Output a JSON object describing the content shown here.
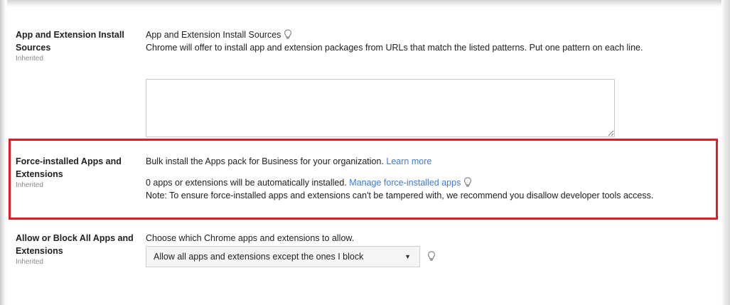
{
  "sections": [
    {
      "title_line1": "App and Extension Install",
      "title_line2": "Sources",
      "status": "Inherited",
      "heading": "App and Extension Install Sources",
      "description": "Chrome will offer to install app and extension packages from URLs that match the listed patterns. Put one pattern on each line.",
      "textarea_value": ""
    },
    {
      "title_line1": "Force-installed Apps and",
      "title_line2": "Extensions",
      "status": "Inherited",
      "bulk_text": "Bulk install the Apps pack for Business for your organization.",
      "learn_more": "Learn more",
      "count_text": "0 apps or extensions will be automatically installed.",
      "manage_link": "Manage force-installed apps",
      "note": "Note: To ensure force-installed apps and extensions can't be tampered with, we recommend you disallow developer tools access."
    },
    {
      "title_line1": "Allow or Block All Apps and",
      "title_line2": "Extensions",
      "status": "Inherited",
      "description": "Choose which Chrome apps and extensions to allow.",
      "select_value": "Allow all apps and extensions except the ones I block"
    }
  ],
  "icons": {
    "hint": "lightbulb-icon",
    "dropdown": "dropdown-arrow-icon"
  },
  "colors": {
    "link": "#3b78e7",
    "highlight_border": "#e31b23",
    "muted_text": "#8a8a8a"
  }
}
